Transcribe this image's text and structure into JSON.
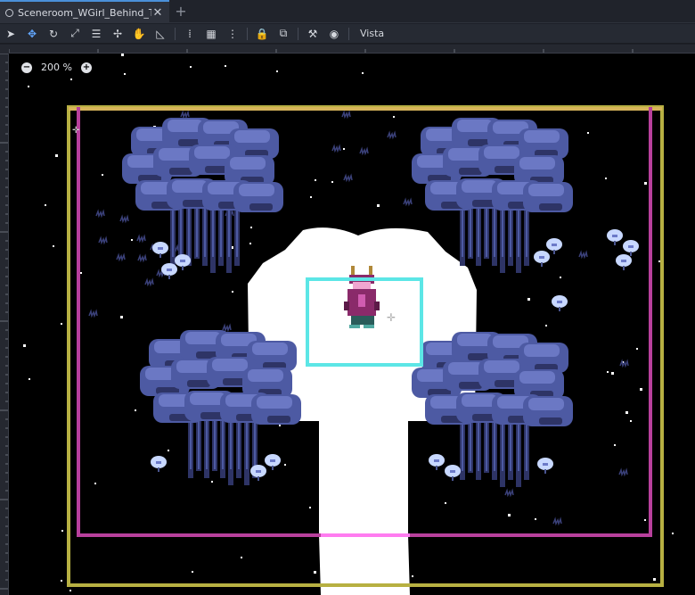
{
  "tab": {
    "title": "Sceneroom_WGirl_Behind_Tree",
    "close_glyph": "✕",
    "add_glyph": "+"
  },
  "toolbar": {
    "tools": [
      {
        "name": "select-tool",
        "glyph": "➤"
      },
      {
        "name": "move-tool",
        "glyph": "✥",
        "active": true
      },
      {
        "name": "rotate-tool",
        "glyph": "↻"
      },
      {
        "name": "scale-tool",
        "glyph": "⤢"
      },
      {
        "name": "list-select-tool",
        "glyph": "☰"
      },
      {
        "name": "pivot-tool",
        "glyph": "✢"
      },
      {
        "name": "pan-tool",
        "glyph": "✋"
      },
      {
        "name": "ruler-tool",
        "glyph": "◺"
      }
    ],
    "tools2": [
      {
        "name": "snap-tool",
        "glyph": "⁞"
      },
      {
        "name": "grid-tool",
        "glyph": "▦"
      },
      {
        "name": "more-icon",
        "glyph": "⋮"
      }
    ],
    "tools3": [
      {
        "name": "lock-icon",
        "glyph": "🔒"
      },
      {
        "name": "group-icon",
        "glyph": "⧉"
      }
    ],
    "tools4": [
      {
        "name": "bone-icon",
        "glyph": "⚒"
      },
      {
        "name": "camera-icon",
        "glyph": "◉"
      }
    ],
    "view_label": "Vista"
  },
  "zoom": {
    "minus": "−",
    "value": "200 %",
    "plus": "+"
  },
  "colors": {
    "bg": "#000000",
    "tree_light": "#6b78c4",
    "tree_dark": "#2e3466",
    "tree_mid": "#4d5aa3",
    "path": "#ffffff",
    "camera_limit": "#b7b042",
    "room_border": "#b8409c",
    "selection": "#5ce6e6",
    "top_border": "#d7b45a"
  }
}
